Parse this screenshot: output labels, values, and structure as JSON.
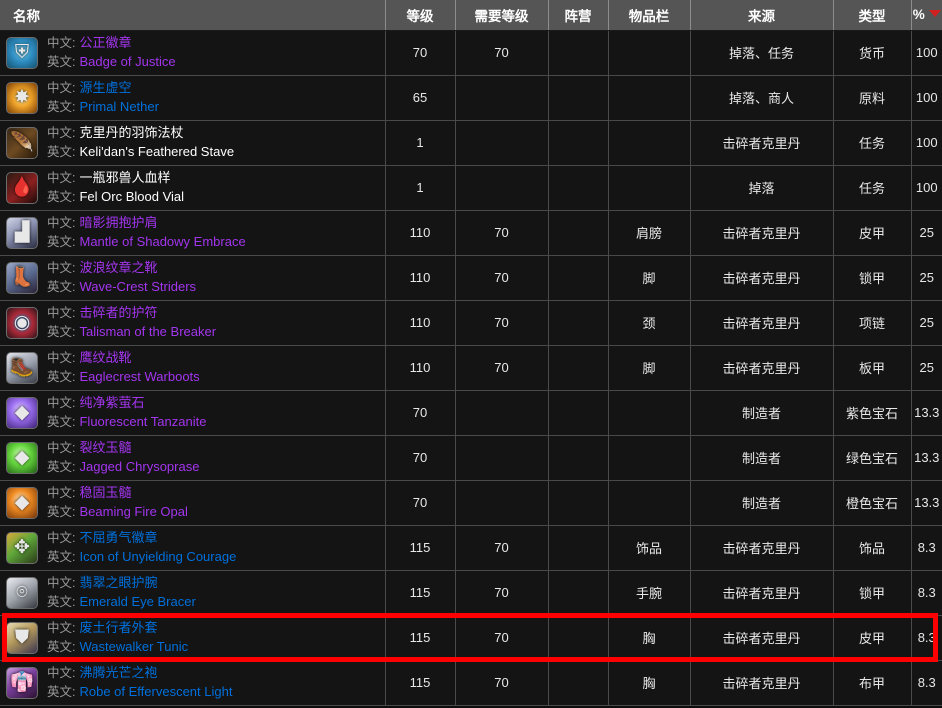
{
  "table": {
    "columns": [
      {
        "key": "name",
        "label": "名称"
      },
      {
        "key": "level",
        "label": "等级"
      },
      {
        "key": "reqlevel",
        "label": "需要等级"
      },
      {
        "key": "faction",
        "label": "阵营"
      },
      {
        "key": "slot",
        "label": "物品栏"
      },
      {
        "key": "source",
        "label": "来源"
      },
      {
        "key": "type",
        "label": "类型"
      },
      {
        "key": "pct",
        "label": "%"
      }
    ],
    "sort": {
      "column": "pct",
      "direction": "desc",
      "arrow_color": "#d02020"
    },
    "labels": {
      "cn": "中文:",
      "en": "英文:"
    },
    "quality_colors": {
      "epic": "#a335ee",
      "rare": "#0070dd",
      "common": "#ffffff"
    },
    "rows": [
      {
        "icon": "badge-of-justice-icon",
        "icon_glyph": "⛨",
        "icon_bg": "radial-gradient(circle at 50% 45%, #7fd9f5 0%, #2f8fc4 45%, #14506e 100%)",
        "name_cn": "公正徽章",
        "name_en": "Badge of Justice",
        "quality": "epic",
        "level": "70",
        "reqlevel": "70",
        "faction": "",
        "slot": "",
        "source": "掉落、任务",
        "type": "货币",
        "pct": "100",
        "highlighted": false
      },
      {
        "icon": "primal-nether-icon",
        "icon_glyph": "✸",
        "icon_bg": "radial-gradient(circle at 50% 50%, #ffe9a0 0%, #f2a62a 40%, #7a3d05 100%)",
        "name_cn": "源生虚空",
        "name_en": "Primal Nether",
        "quality": "rare",
        "level": "65",
        "reqlevel": "",
        "faction": "",
        "slot": "",
        "source": "掉落、商人",
        "type": "原料",
        "pct": "100",
        "highlighted": false
      },
      {
        "icon": "feathered-stave-icon",
        "icon_glyph": "🪶",
        "icon_bg": "linear-gradient(135deg, #3a2a18 0%, #6e4a22 50%, #241708 100%)",
        "name_cn": "克里丹的羽饰法杖",
        "name_en": "Keli'dan's Feathered Stave",
        "quality": "common",
        "level": "1",
        "reqlevel": "",
        "faction": "",
        "slot": "",
        "source": "击碎者克里丹",
        "type": "任务",
        "pct": "100",
        "highlighted": false
      },
      {
        "icon": "blood-vial-icon",
        "icon_glyph": "🩸",
        "icon_bg": "linear-gradient(140deg, #2a1a12 0%, #8c2020 55%, #1a0a08 100%)",
        "name_cn": "一瓶邪兽人血样",
        "name_en": "Fel Orc Blood Vial",
        "quality": "common",
        "level": "1",
        "reqlevel": "",
        "faction": "",
        "slot": "",
        "source": "掉落",
        "type": "任务",
        "pct": "100",
        "highlighted": false
      },
      {
        "icon": "shoulder-armor-icon",
        "icon_glyph": "▟",
        "icon_bg": "linear-gradient(150deg, #cfd4e6 0%, #8a90b0 45%, #2a2d42 100%)",
        "name_cn": "暗影拥抱护肩",
        "name_en": "Mantle of Shadowy Embrace",
        "quality": "epic",
        "level": "110",
        "reqlevel": "70",
        "faction": "",
        "slot": "肩膀",
        "source": "击碎者克里丹",
        "type": "皮甲",
        "pct": "25",
        "highlighted": false
      },
      {
        "icon": "boots-icon",
        "icon_glyph": "👢",
        "icon_bg": "linear-gradient(150deg, #9aa8c8 0%, #5a6a90 50%, #2a2235 100%)",
        "name_cn": "波浪纹章之靴",
        "name_en": "Wave-Crest Striders",
        "quality": "epic",
        "level": "110",
        "reqlevel": "70",
        "faction": "",
        "slot": "脚",
        "source": "击碎者克里丹",
        "type": "锁甲",
        "pct": "25",
        "highlighted": false
      },
      {
        "icon": "talisman-eye-icon",
        "icon_glyph": "◉",
        "icon_bg": "radial-gradient(circle at 50% 50%, #ffffff 0%, #4a9ad6 18%, #b02a3a 48%, #2a1418 100%)",
        "name_cn": "击碎者的护符",
        "name_en": "Talisman of the Breaker",
        "quality": "epic",
        "level": "110",
        "reqlevel": "70",
        "faction": "",
        "slot": "颈",
        "source": "击碎者克里丹",
        "type": "项链",
        "pct": "25",
        "highlighted": false
      },
      {
        "icon": "warboots-icon",
        "icon_glyph": "🥾",
        "icon_bg": "linear-gradient(150deg, #e2e4ea 0%, #9aa0ae 50%, #3a3d46 100%)",
        "name_cn": "鹰纹战靴",
        "name_en": "Eaglecrest Warboots",
        "quality": "epic",
        "level": "110",
        "reqlevel": "70",
        "faction": "",
        "slot": "脚",
        "source": "击碎者克里丹",
        "type": "板甲",
        "pct": "25",
        "highlighted": false
      },
      {
        "icon": "purple-gem-icon",
        "icon_glyph": "◆",
        "icon_bg": "radial-gradient(circle at 45% 40%, #e3d2ff 0%, #9b6ef0 40%, #3a1f72 100%)",
        "name_cn": "纯净紫萤石",
        "name_en": "Fluorescent Tanzanite",
        "quality": "epic",
        "level": "70",
        "reqlevel": "",
        "faction": "",
        "slot": "",
        "source": "制造者",
        "type": "紫色宝石",
        "pct": "13.3",
        "highlighted": false
      },
      {
        "icon": "green-gem-icon",
        "icon_glyph": "◆",
        "icon_bg": "radial-gradient(circle at 45% 40%, #dcffc8 0%, #68d93f 40%, #1d5c12 100%)",
        "name_cn": "裂纹玉髓",
        "name_en": "Jagged Chrysoprase",
        "quality": "epic",
        "level": "70",
        "reqlevel": "",
        "faction": "",
        "slot": "",
        "source": "制造者",
        "type": "绿色宝石",
        "pct": "13.3",
        "highlighted": false
      },
      {
        "icon": "orange-gem-icon",
        "icon_glyph": "◆",
        "icon_bg": "radial-gradient(circle at 45% 40%, #ffe6c0 0%, #ef8a22 40%, #70330a 100%)",
        "name_cn": "稳固玉髓",
        "name_en": "Beaming Fire Opal",
        "quality": "epic",
        "level": "70",
        "reqlevel": "",
        "faction": "",
        "slot": "",
        "source": "制造者",
        "type": "橙色宝石",
        "pct": "13.3",
        "highlighted": false
      },
      {
        "icon": "trinket-icon",
        "icon_glyph": "✥",
        "icon_bg": "linear-gradient(140deg, #d8a83a 0%, #5fa83a 45%, #2a3a18 100%)",
        "name_cn": "不屈勇气徽章",
        "name_en": "Icon of Unyielding Courage",
        "quality": "rare",
        "level": "115",
        "reqlevel": "70",
        "faction": "",
        "slot": "饰品",
        "source": "击碎者克里丹",
        "type": "饰品",
        "pct": "8.3",
        "highlighted": false
      },
      {
        "icon": "bracer-icon",
        "icon_glyph": "⌾",
        "icon_bg": "linear-gradient(145deg, #e8eaee 0%, #9fa4ac 50%, #33363c 100%)",
        "name_cn": "翡翠之眼护腕",
        "name_en": "Emerald Eye Bracer",
        "quality": "rare",
        "level": "115",
        "reqlevel": "70",
        "faction": "",
        "slot": "手腕",
        "source": "击碎者克里丹",
        "type": "锁甲",
        "pct": "8.3",
        "highlighted": false
      },
      {
        "icon": "tunic-icon",
        "icon_glyph": "⛊",
        "icon_bg": "linear-gradient(145deg, #e6d9b0 0%, #b59a5c 45%, #3a3550 100%)",
        "name_cn": "废土行者外套",
        "name_en": "Wastewalker Tunic",
        "quality": "rare",
        "level": "115",
        "reqlevel": "70",
        "faction": "",
        "slot": "胸",
        "source": "击碎者克里丹",
        "type": "皮甲",
        "pct": "8.3",
        "highlighted": true
      },
      {
        "icon": "robe-icon",
        "icon_glyph": "👘",
        "icon_bg": "linear-gradient(145deg, #c79ae0 0%, #7a3f9c 45%, #2a1030 100%)",
        "name_cn": "沸腾光芒之袍",
        "name_en": "Robe of Effervescent Light",
        "quality": "rare",
        "level": "115",
        "reqlevel": "70",
        "faction": "",
        "slot": "胸",
        "source": "击碎者克里丹",
        "type": "布甲",
        "pct": "8.3",
        "highlighted": false
      }
    ]
  },
  "highlight": {
    "color": "#ff0000",
    "target_row_index": 13
  }
}
